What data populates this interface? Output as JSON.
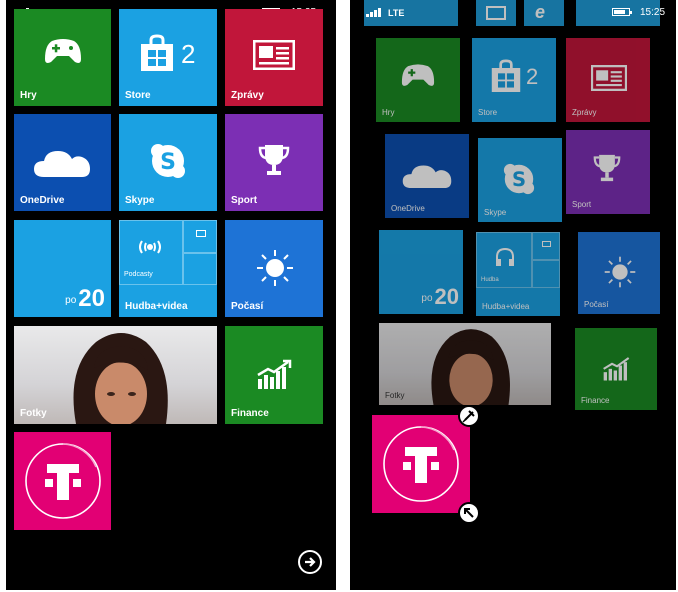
{
  "status": {
    "network": "LTE",
    "time": "15:25"
  },
  "left": {
    "tiles": {
      "games": "Hry",
      "store": "Store",
      "store_count": "2",
      "news": "Zprávy",
      "onedrive": "OneDrive",
      "skype": "Skype",
      "sport": "Sport",
      "people_prefix": "po",
      "people_count": "20",
      "podcasts": "Podcasty",
      "music": "Hudba+videa",
      "weather": "Počasí",
      "photos": "Fotky",
      "finance": "Finance"
    }
  },
  "right": {
    "tiles": {
      "games": "Hry",
      "store": "Store",
      "store_count": "2",
      "news": "Zprávy",
      "onedrive": "OneDrive",
      "skype": "Skype",
      "sport": "Sport",
      "people_prefix": "po",
      "people_count": "20",
      "music_sub": "Hudba",
      "music": "Hudba+videa",
      "weather": "Počasí",
      "photos": "Fotky",
      "finance": "Finance"
    }
  },
  "icons": {
    "games": "gamepad-icon",
    "store": "store-bag-icon",
    "news": "newspaper-icon",
    "onedrive": "cloud-icon",
    "skype": "skype-icon",
    "sport": "trophy-icon",
    "podcasts": "podcast-icon",
    "weather": "sun-icon",
    "finance": "chart-icon",
    "tmobile": "t-logo-icon",
    "all_apps": "arrow-right-circle-icon"
  },
  "colors": {
    "green": "#1b8a23",
    "blue": "#1ba1e2",
    "red": "#c1163a",
    "purple": "#7c2fb4",
    "magenta": "#e20074"
  }
}
